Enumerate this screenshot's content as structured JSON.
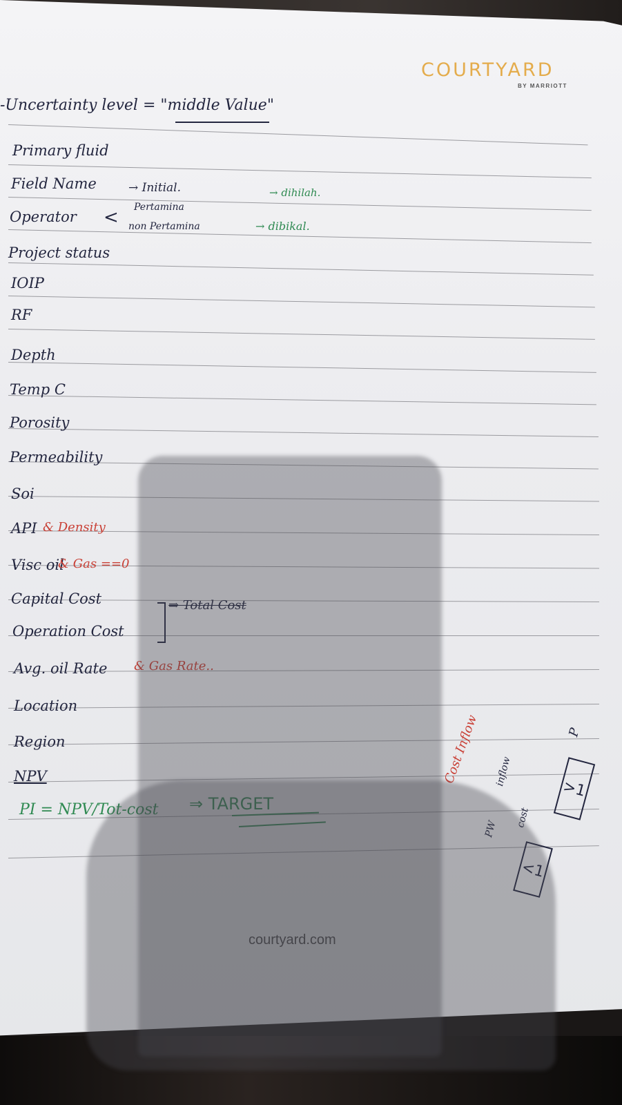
{
  "logo": {
    "brand": "COURTYARD",
    "sub": "BY MARRIOTT"
  },
  "footer": {
    "website": "courtyard.com"
  },
  "header": {
    "line": "-Uncertainty level = \"middle Value\""
  },
  "items": [
    "Primary fluid",
    "Field Name",
    "Operator",
    "Project status",
    "IOIP",
    "RF",
    "Depth",
    "Temp C",
    "Porosity",
    "Permeability",
    "Soi",
    "API",
    "Visc oil",
    "Capital Cost",
    "Operation Cost",
    "Avg. oil Rate",
    "Location",
    "Region",
    "NPV"
  ],
  "notes": {
    "field_arrow": "→ Initial.",
    "field_arrow2": "→ dihilah.",
    "operator_a": "Pertamina",
    "operator_b": "non Pertamina",
    "operator_arrow": "→ dibikal.",
    "api_add": "& Density",
    "visc_add": "& Gas ==0",
    "cost_total": "⇒ Total Cost",
    "rate_add": "& Gas Rate..",
    "pi_formula": "PI = NPV/Tot-cost",
    "pi_target": "⇒ TARGET",
    "side_red": "Cost Inflow",
    "side_inflow": "inflow",
    "side_cost": "cost",
    "side_pw": "PW",
    "box_gt": ">1",
    "box_lt": "<1",
    "side_p": "P"
  }
}
